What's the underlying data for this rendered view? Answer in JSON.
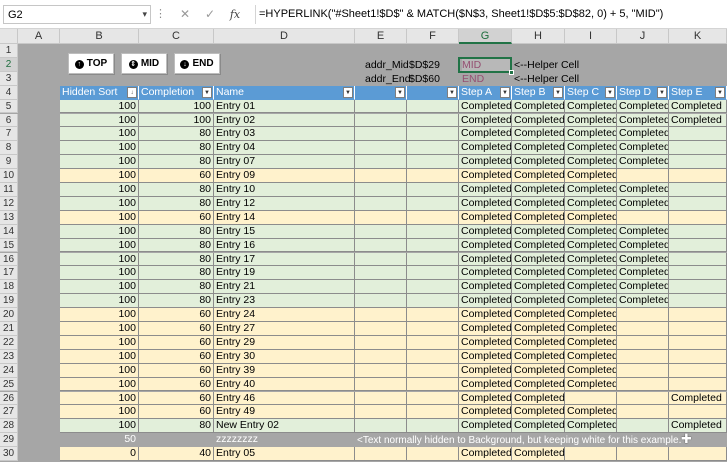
{
  "formula_bar": {
    "name_box": "G2",
    "dots": "⋮",
    "cancel_symbol": "✕",
    "enter_symbol": "✓",
    "function_symbol": "fx",
    "formula": "=HYPERLINK(\"#Sheet1!$D$\" & MATCH($N$3, Sheet1!$D$5:$D$82, 0) + 5, \"MID\")"
  },
  "columns": [
    "A",
    "B",
    "C",
    "D",
    "E",
    "F",
    "G",
    "H",
    "I",
    "J",
    "K"
  ],
  "selected_column": "G",
  "selected_row": "2",
  "buttons": {
    "top_label": "TOP",
    "mid_label": "MID",
    "end_label": "END"
  },
  "helper": {
    "row2_label": "addr_Mid",
    "row2_addr": "$D$29",
    "row2_link": "MID",
    "row2_note": "<--Helper Cell",
    "row3_label": "addr_End",
    "row3_addr": "$D$60",
    "row3_link": "END",
    "row3_note": "<--Helper Cell"
  },
  "table": {
    "headers": [
      "Hidden Sort",
      "Completion",
      "Name",
      "",
      "",
      "Step A",
      "Step B",
      "Step C",
      "Step D",
      "Step E"
    ],
    "rows": [
      {
        "row": "5",
        "sort": "100",
        "completion": "100",
        "name": "Entry 01",
        "color": "grn",
        "steps": [
          "Completed",
          "Completed",
          "Completed",
          "Completed",
          "Completed"
        ]
      },
      {
        "row": "6",
        "sort": "100",
        "completion": "100",
        "name": "Entry 02",
        "color": "grn",
        "steps": [
          "Completed",
          "Completed",
          "Completed",
          "Completed",
          "Completed"
        ]
      },
      {
        "row": "7",
        "sort": "100",
        "completion": "80",
        "name": "Entry 03",
        "color": "grn",
        "steps": [
          "Completed",
          "Completed",
          "Completed",
          "Completed",
          ""
        ]
      },
      {
        "row": "8",
        "sort": "100",
        "completion": "80",
        "name": "Entry 04",
        "color": "grn",
        "steps": [
          "Completed",
          "Completed",
          "Completed",
          "Completed",
          ""
        ]
      },
      {
        "row": "9",
        "sort": "100",
        "completion": "80",
        "name": "Entry 07",
        "color": "grn",
        "steps": [
          "Completed",
          "Completed",
          "Completed",
          "Completed",
          ""
        ]
      },
      {
        "row": "10",
        "sort": "100",
        "completion": "60",
        "name": "Entry 09",
        "color": "org",
        "steps": [
          "Completed",
          "Completed",
          "Completed",
          "",
          ""
        ]
      },
      {
        "row": "11",
        "sort": "100",
        "completion": "80",
        "name": "Entry 10",
        "color": "grn",
        "steps": [
          "Completed",
          "Completed",
          "Completed",
          "Completed",
          ""
        ]
      },
      {
        "row": "12",
        "sort": "100",
        "completion": "80",
        "name": "Entry 12",
        "color": "grn",
        "steps": [
          "Completed",
          "Completed",
          "Completed",
          "Completed",
          ""
        ]
      },
      {
        "row": "13",
        "sort": "100",
        "completion": "60",
        "name": "Entry 14",
        "color": "org",
        "steps": [
          "Completed",
          "Completed",
          "Completed",
          "",
          ""
        ]
      },
      {
        "row": "14",
        "sort": "100",
        "completion": "80",
        "name": "Entry 15",
        "color": "grn",
        "steps": [
          "Completed",
          "Completed",
          "Completed",
          "Completed",
          ""
        ]
      },
      {
        "row": "15",
        "sort": "100",
        "completion": "80",
        "name": "Entry 16",
        "color": "grn",
        "steps": [
          "Completed",
          "Completed",
          "Completed",
          "Completed",
          ""
        ]
      },
      {
        "row": "16",
        "sort": "100",
        "completion": "80",
        "name": "Entry 17",
        "color": "grn",
        "steps": [
          "Completed",
          "Completed",
          "Completed",
          "Completed",
          ""
        ]
      },
      {
        "row": "17",
        "sort": "100",
        "completion": "80",
        "name": "Entry 19",
        "color": "grn",
        "steps": [
          "Completed",
          "Completed",
          "Completed",
          "Completed",
          ""
        ]
      },
      {
        "row": "18",
        "sort": "100",
        "completion": "80",
        "name": "Entry 21",
        "color": "grn",
        "steps": [
          "Completed",
          "Completed",
          "Completed",
          "Completed",
          ""
        ]
      },
      {
        "row": "19",
        "sort": "100",
        "completion": "80",
        "name": "Entry 23",
        "color": "grn",
        "steps": [
          "Completed",
          "Completed",
          "Completed",
          "Completed",
          ""
        ]
      },
      {
        "row": "20",
        "sort": "100",
        "completion": "60",
        "name": "Entry 24",
        "color": "org",
        "steps": [
          "Completed",
          "Completed",
          "Completed",
          "",
          ""
        ]
      },
      {
        "row": "21",
        "sort": "100",
        "completion": "60",
        "name": "Entry 27",
        "color": "org",
        "steps": [
          "Completed",
          "Completed",
          "Completed",
          "",
          ""
        ]
      },
      {
        "row": "22",
        "sort": "100",
        "completion": "60",
        "name": "Entry 29",
        "color": "org",
        "steps": [
          "Completed",
          "Completed",
          "Completed",
          "",
          ""
        ]
      },
      {
        "row": "23",
        "sort": "100",
        "completion": "60",
        "name": "Entry 30",
        "color": "org",
        "steps": [
          "Completed",
          "Completed",
          "Completed",
          "",
          ""
        ]
      },
      {
        "row": "24",
        "sort": "100",
        "completion": "60",
        "name": "Entry 39",
        "color": "org",
        "steps": [
          "Completed",
          "Completed",
          "Completed",
          "",
          ""
        ]
      },
      {
        "row": "25",
        "sort": "100",
        "completion": "60",
        "name": "Entry 40",
        "color": "org",
        "steps": [
          "Completed",
          "Completed",
          "Completed",
          "",
          ""
        ]
      },
      {
        "row": "26",
        "sort": "100",
        "completion": "60",
        "name": "Entry 46",
        "color": "org",
        "steps": [
          "Completed",
          "Completed",
          "",
          "",
          "Completed"
        ]
      },
      {
        "row": "27",
        "sort": "100",
        "completion": "60",
        "name": "Entry 49",
        "color": "org",
        "steps": [
          "Completed",
          "Completed",
          "Completed",
          "",
          ""
        ]
      },
      {
        "row": "28",
        "sort": "100",
        "completion": "80",
        "name": "New Entry 02",
        "color": "grn",
        "steps": [
          "Completed",
          "Completed",
          "Completed",
          "",
          "Completed"
        ]
      }
    ],
    "mid_row": {
      "row": "29",
      "sort": "50",
      "name": "zzzzzzzz",
      "note": "<Text normally hidden to Background, but keeping white for this example."
    },
    "last_row": {
      "row": "30",
      "sort": "0",
      "completion": "40",
      "name": "Entry 05",
      "color": "org",
      "steps": [
        "Completed",
        "Completed",
        "",
        "",
        ""
      ]
    }
  },
  "colors": {
    "header_blue": "#5b9bd5",
    "row_green": "#e2efda",
    "row_orange": "#fff2cc",
    "selection_green": "#217346",
    "link_purple": "#954f72"
  }
}
